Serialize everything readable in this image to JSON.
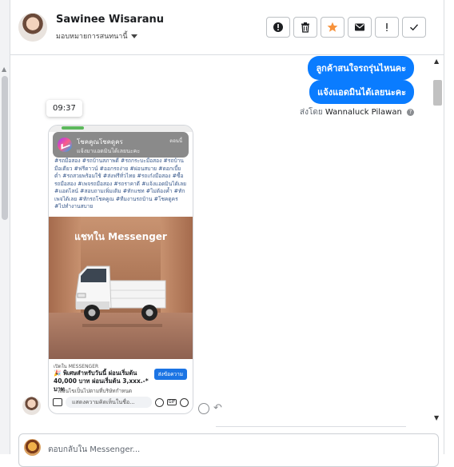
{
  "header": {
    "contact_name": "Sawinee Wisaranu",
    "subtitle": "มอบหมายการสนทนานี้",
    "actions": [
      {
        "name": "alert-circle-icon",
        "label": "!"
      },
      {
        "name": "trash-icon",
        "label": ""
      },
      {
        "name": "star-icon",
        "label": ""
      },
      {
        "name": "mail-icon",
        "label": ""
      },
      {
        "name": "exclamation-icon",
        "label": "!"
      },
      {
        "name": "check-icon",
        "label": ""
      }
    ],
    "star_color": "#f7923b"
  },
  "messages": {
    "outgoing": [
      "ลูกค้าสนใจรถรุ่นไหนคะ",
      "แจ้งแอดมินได้เลยนะคะ"
    ],
    "sent_by_prefix": "ส่งโดย",
    "sent_by_name": "Wannaluck Pilawan",
    "timestamp": "09:37",
    "bubble_color": "#0a7cff"
  },
  "screenshot": {
    "notif_title": "โชคคูณโชคดูคร",
    "notif_text": "แจ้งมาแอดมินได้เลยนะคะ",
    "notif_time": "ตอนนี้",
    "hashtags": "#รถมือสอง #รถบ้านสภาพดี #รถกระบะมือสอง #รถบ้านมือเดียว #ฟรีดาวน์ #ออกรถง่าย #ผ่อนสบาย #ดอกเบี้ยต่ำ #รถสวยพร้อมใช้ #ส่งฟรีทั่วไทย #รถเก๋งมือสอง #ซื้อรถมือสอง #เพจรถมือสอง #รถราคาดี #แจ้งแอดมินได้เลย #แอดไลน์ #สอบถามเพิ่มเติม #ทักแชท #ไม่ต้องค้ำ #ทักเพจได้เลย #ทักรถโชคคูณ #ทีมงานรถบ้าน #โชคดูคร #ไปทำงานสบาย",
    "headline": "แชทใน Messenger",
    "caption": "เปิดใน MESSENGER",
    "promo": "🎉 พิเศษสำหรับวันนี้ ผ่อนเริ่มต้น 40,000 บาท ผ่อนเริ่มต้น 3,xxx.-* บาท",
    "promo_button": "ส่งข้อความ",
    "promo_line2": "* เงื่อนไขเป็นไปตามที่บริษัทกำหนด",
    "input_placeholder": "แสดงความคิดเห็นในชื่อ..."
  },
  "composer": {
    "placeholder": "ตอบกลับใน Messenger..."
  }
}
